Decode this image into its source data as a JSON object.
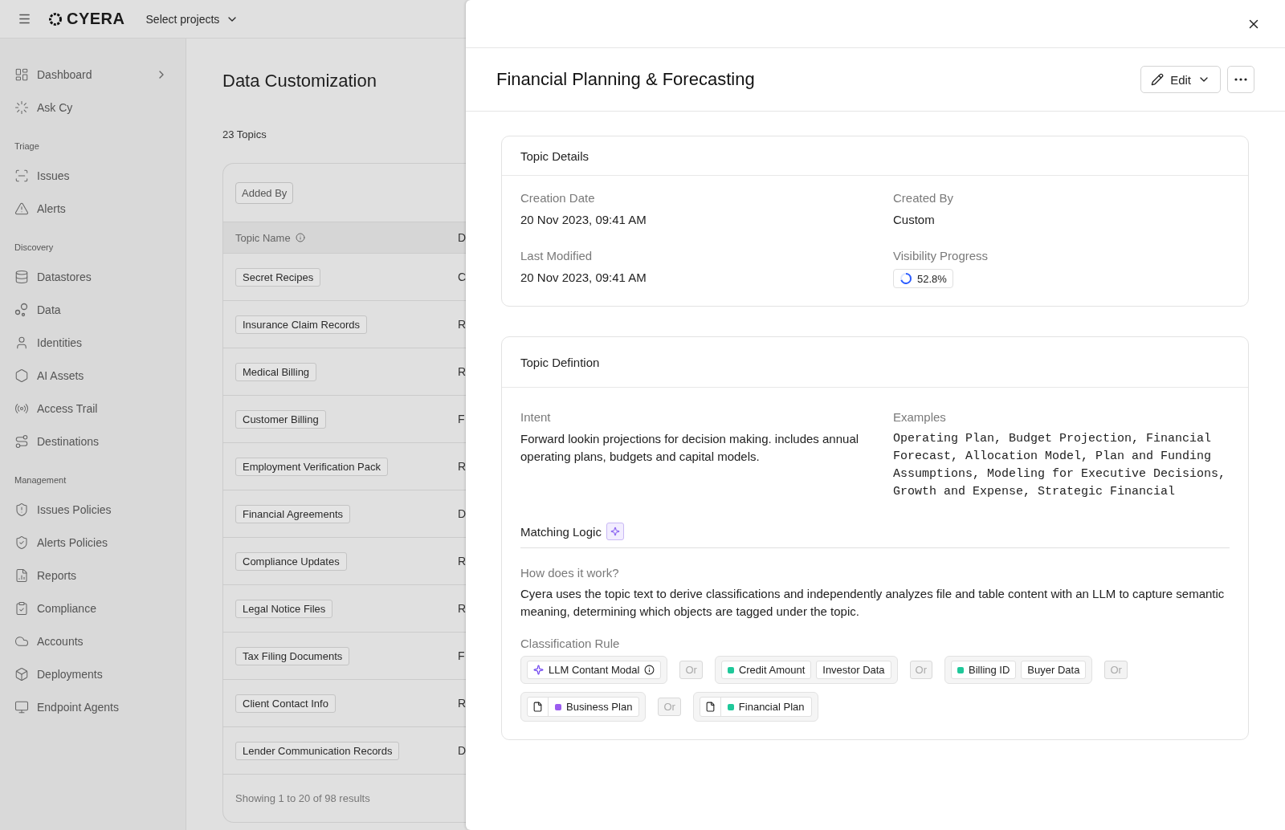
{
  "top_bar": {
    "logo": "CYERA",
    "project_selector": "Select projects"
  },
  "sidebar": {
    "sections": [
      {
        "items": [
          {
            "label": "Dashboard",
            "has_submenu": true
          },
          {
            "label": "Ask Cy",
            "has_submenu": false
          }
        ]
      },
      {
        "title": "Triage",
        "items": [
          {
            "label": "Issues",
            "has_submenu": false
          },
          {
            "label": "Alerts",
            "has_submenu": false
          }
        ]
      },
      {
        "title": "Discovery",
        "items": [
          {
            "label": "Datastores",
            "has_submenu": false
          },
          {
            "label": "Data",
            "has_submenu": false
          },
          {
            "label": "Identities",
            "has_submenu": false
          },
          {
            "label": "AI Assets",
            "has_submenu": false
          },
          {
            "label": "Access Trail",
            "has_submenu": false
          },
          {
            "label": "Destinations",
            "has_submenu": false
          }
        ]
      },
      {
        "title": "Management",
        "items": [
          {
            "label": "Issues Policies",
            "has_submenu": false
          },
          {
            "label": "Alerts Policies",
            "has_submenu": false
          },
          {
            "label": "Reports",
            "has_submenu": false
          },
          {
            "label": "Compliance",
            "has_submenu": false
          },
          {
            "label": "Accounts",
            "has_submenu": false
          },
          {
            "label": "Deployments",
            "has_submenu": false
          },
          {
            "label": "Endpoint Agents",
            "has_submenu": false
          }
        ]
      }
    ]
  },
  "page": {
    "title": "Data Customization",
    "count": "23 Topics",
    "filter_button": "Added By",
    "table": {
      "columns": [
        "Topic Name",
        "D"
      ],
      "rows": [
        [
          "Secret Recipes",
          "C"
        ],
        [
          "Insurance Claim Records",
          "R"
        ],
        [
          "Medical Billing",
          "R"
        ],
        [
          "Customer Billing",
          "F"
        ],
        [
          "Employment Verification Pack",
          "R"
        ],
        [
          "Financial Agreements",
          "D"
        ],
        [
          "Compliance Updates",
          "R"
        ],
        [
          "Legal Notice Files",
          "R"
        ],
        [
          "Tax Filing Documents",
          "F"
        ],
        [
          "Client Contact Info",
          "R"
        ],
        [
          "Lender Communication Records",
          "D"
        ]
      ],
      "footer": "Showing 1 to 20 of 98 results"
    }
  },
  "drawer": {
    "title": "Financial Planning & Forecasting",
    "edit_button": "Edit",
    "details": {
      "title": "Topic Details",
      "fields": [
        {
          "label": "Creation Date",
          "value": "20 Nov 2023, 09:41 AM"
        },
        {
          "label": "Created By",
          "value": "Custom"
        },
        {
          "label": "Last Modified",
          "value": "20 Nov 2023, 09:41 AM"
        },
        {
          "label": "Visibility Progress",
          "value": "52.8%",
          "kind": "progress"
        }
      ]
    },
    "definition": {
      "title": "Topic Defintion",
      "intent": {
        "label": "Intent",
        "value": "Forward lookin projections for decision making. includes annual operating plans, budgets and capital models."
      },
      "examples": {
        "label": "Examples",
        "value": "Operating Plan, Budget Projection, Financial Forecast, Allocation Model, Plan and Funding Assumptions, Modeling for Executive Decisions, Growth and Expense, Strategic Financial"
      },
      "matching_logic": "Matching Logic",
      "how_label": "How does it work?",
      "how_text": "Cyera uses the topic text to derive classifications and independently analyzes file and table content with an LLM to capture semantic meaning, determining which objects are tagged under the topic.",
      "rule_label": "Classification Rule",
      "rules": [
        {
          "kind": "group",
          "items": [
            {
              "kind": "ai",
              "label": "LLM Contant Modal"
            }
          ]
        },
        {
          "kind": "or",
          "label": "Or"
        },
        {
          "kind": "group",
          "items": [
            {
              "kind": "dot",
              "label": "Credit Amount",
              "color": "#1fc89a"
            },
            {
              "kind": "plain",
              "label": "Investor Data"
            }
          ]
        },
        {
          "kind": "or",
          "label": "Or"
        },
        {
          "kind": "group",
          "items": [
            {
              "kind": "dot",
              "label": "Billing ID",
              "color": "#1fc89a"
            },
            {
              "kind": "plain",
              "label": "Buyer Data"
            }
          ]
        },
        {
          "kind": "or",
          "label": "Or"
        },
        {
          "kind": "group",
          "items": [
            {
              "kind": "file",
              "label": "Business Plan",
              "color": "#9b5cf0"
            }
          ]
        },
        {
          "kind": "or",
          "label": "Or"
        },
        {
          "kind": "group",
          "items": [
            {
              "kind": "file",
              "label": "Financial Plan",
              "color": "#1fc89a"
            }
          ]
        }
      ]
    }
  }
}
